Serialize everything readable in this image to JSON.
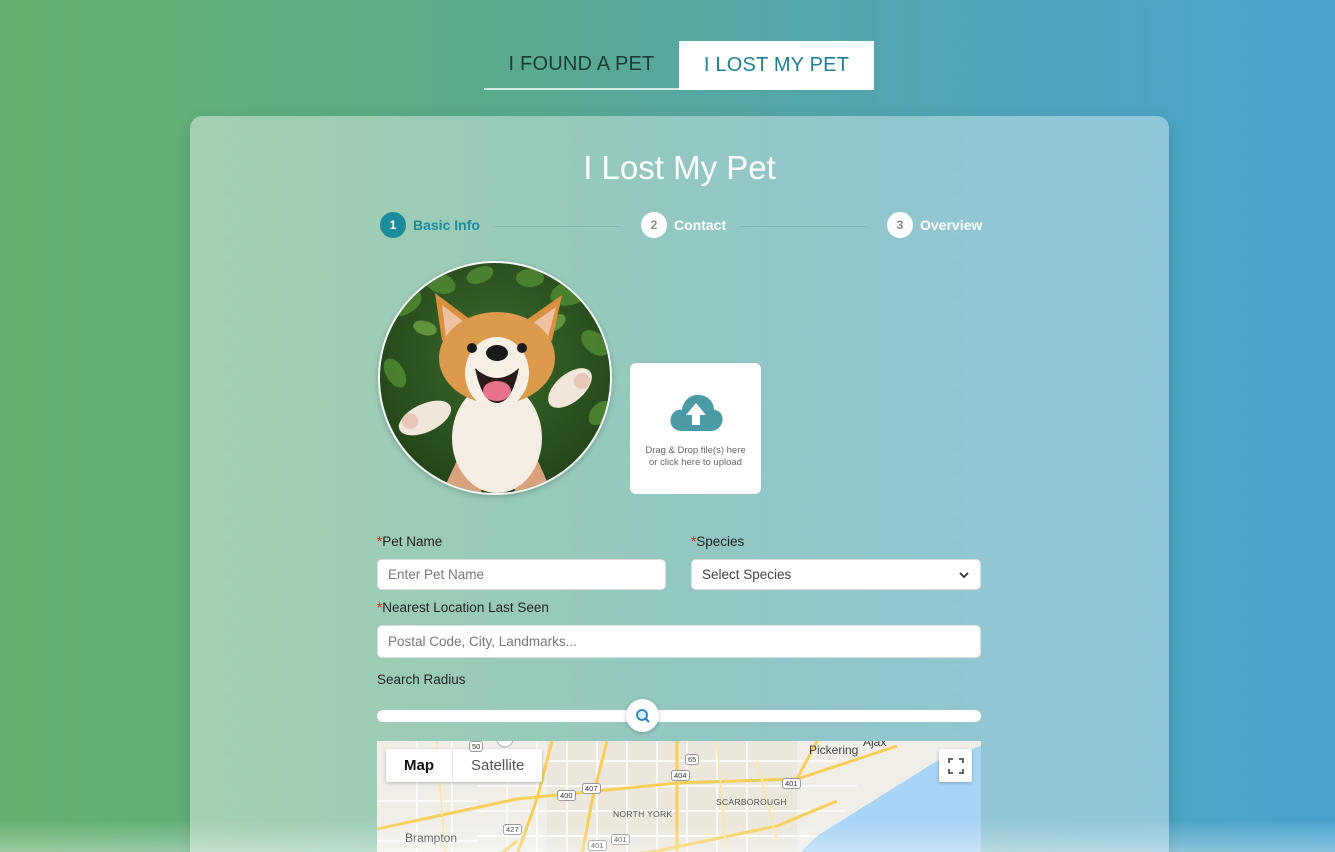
{
  "tabs": {
    "found": "I FOUND A PET",
    "lost": "I LOST MY PET"
  },
  "card": {
    "title": "I Lost My Pet"
  },
  "stepper": [
    {
      "number": "1",
      "label": "Basic Info",
      "state": "active"
    },
    {
      "number": "2",
      "label": "Contact",
      "state": "idle"
    },
    {
      "number": "3",
      "label": "Overview",
      "state": "idle"
    }
  ],
  "upload": {
    "line1": "Drag & Drop file(s) here",
    "line2": "or click here to upload",
    "icon": "cloud-upload-icon"
  },
  "form": {
    "required_mark": "*",
    "pet_name_label": "Pet Name",
    "pet_name_placeholder": "Enter Pet Name",
    "species_label": "Species",
    "species_value": "Select Species",
    "location_label": "Nearest Location Last Seen",
    "location_placeholder": "Postal Code, City, Landmarks...",
    "radius_label": "Search Radius",
    "radius_level": 0.44
  },
  "map": {
    "map_button": "Map",
    "satellite_button": "Satellite",
    "places": {
      "pickering": "Pickering",
      "ajax": "Ajax",
      "north_york": "NORTH YORK",
      "scarborough": "SCARBOROUGH",
      "brampton": "Brampton"
    },
    "highways": {
      "h50": "50",
      "h65": "65",
      "h404": "404",
      "h401a": "401",
      "h407": "407",
      "h400": "400",
      "h427": "427",
      "h401b": "401",
      "h401c": "401"
    }
  },
  "colors": {
    "accent": "#1c8b9b",
    "required": "#dd2222",
    "water": "#a8d4f5"
  }
}
